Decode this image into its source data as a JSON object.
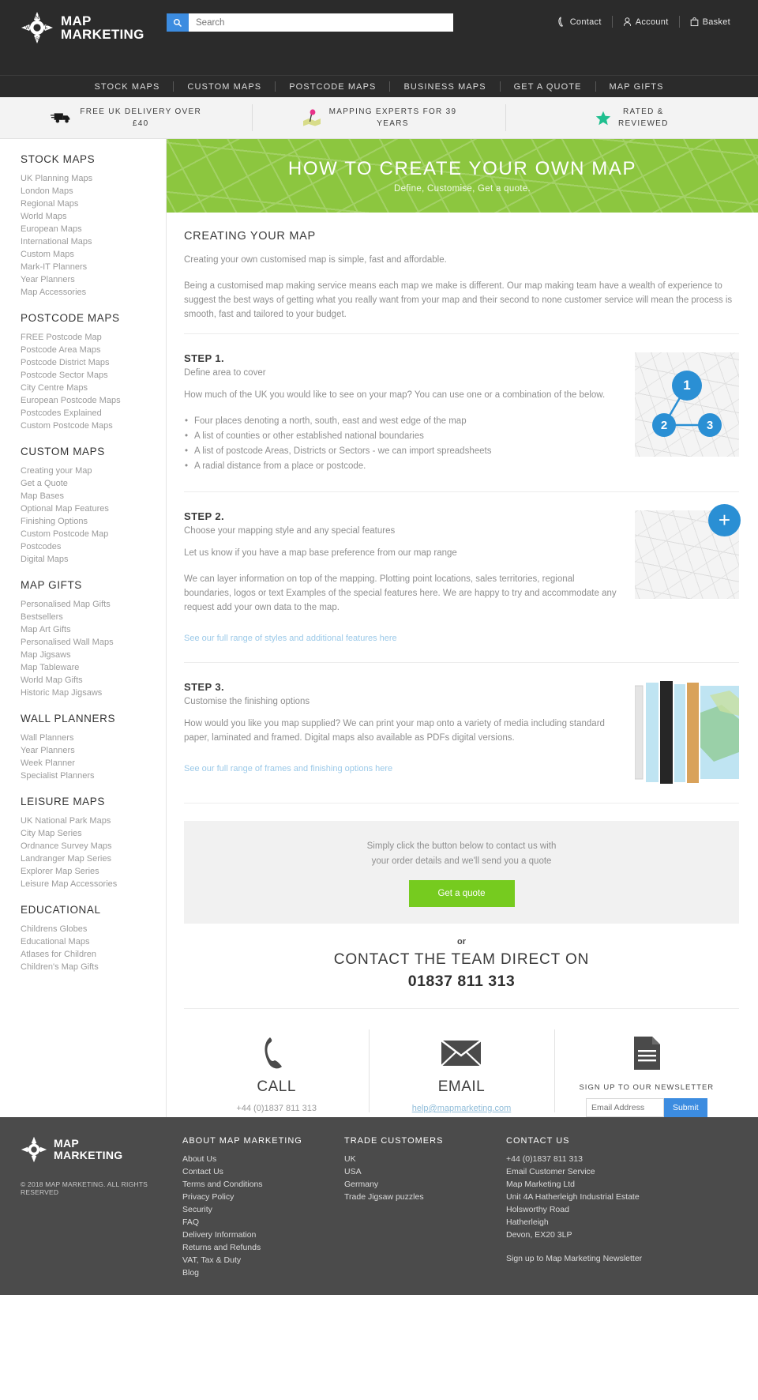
{
  "header": {
    "logo_line1": "MAP",
    "logo_line2": "MARKETING",
    "compass": {
      "n": "N",
      "e": "E",
      "s": "S",
      "w": "W"
    },
    "search": {
      "placeholder": "Search",
      "value": "",
      "icon": "search-icon"
    },
    "utility": [
      {
        "label": "Contact",
        "icon": "phone-icon"
      },
      {
        "label": "Account",
        "icon": "person-icon"
      },
      {
        "label": "Basket",
        "icon": "basket-icon"
      }
    ],
    "nav": [
      "STOCK MAPS",
      "CUSTOM MAPS",
      "POSTCODE MAPS",
      "BUSINESS MAPS",
      "GET A QUOTE",
      "MAP GIFTS"
    ]
  },
  "promo": [
    {
      "icon": "truck-icon",
      "line1": "FREE UK DELIVERY OVER",
      "line2": "£40"
    },
    {
      "icon": "map-pin-icon",
      "line1": "MAPPING EXPERTS FOR 39",
      "line2": "YEARS"
    },
    {
      "icon": "star-icon",
      "line1": "RATED &",
      "line2": "REVIEWED"
    }
  ],
  "sidebar": [
    {
      "heading": "STOCK MAPS",
      "items": [
        "UK Planning Maps",
        "London Maps",
        "Regional Maps",
        "World Maps",
        "European Maps",
        "International Maps",
        "Custom Maps",
        "Mark-IT Planners",
        "Year Planners",
        "Map Accessories"
      ]
    },
    {
      "heading": "POSTCODE MAPS",
      "items": [
        "FREE Postcode Map",
        "Postcode Area Maps",
        "Postcode District Maps",
        "Postcode Sector Maps",
        "City Centre Maps",
        "European Postcode Maps",
        "Postcodes Explained",
        "Custom Postcode Maps"
      ]
    },
    {
      "heading": "CUSTOM MAPS",
      "items": [
        "Creating your Map",
        "Get a Quote",
        "Map Bases",
        "Optional Map Features",
        "Finishing Options",
        "Custom Postcode Map",
        "Postcodes",
        "Digital Maps"
      ]
    },
    {
      "heading": "MAP GIFTS",
      "items": [
        "Personalised Map Gifts",
        "Bestsellers",
        "Map Art Gifts",
        "Personalised Wall Maps",
        "Map Jigsaws",
        "Map Tableware",
        "World Map Gifts",
        "Historic Map Jigsaws"
      ]
    },
    {
      "heading": "WALL PLANNERS",
      "items": [
        "Wall Planners",
        "Year Planners",
        "Week Planner",
        "Specialist Planners"
      ]
    },
    {
      "heading": "LEISURE MAPS",
      "items": [
        "UK National Park Maps",
        "City Map Series",
        "Ordnance Survey Maps",
        "Landranger Map Series",
        "Explorer Map Series",
        "Leisure Map Accessories"
      ]
    },
    {
      "heading": "EDUCATIONAL",
      "items": [
        "Childrens Globes",
        "Educational Maps",
        "Atlases for Children",
        "Children's Map Gifts"
      ]
    }
  ],
  "hero": {
    "title": "HOW TO CREATE YOUR OWN MAP",
    "subtitle": "Define, Customise, Get a quote."
  },
  "main": {
    "section_title": "CREATING YOUR MAP",
    "intro1": "Creating your own customised map is simple, fast and affordable.",
    "intro2": "Being a customised map making service means each map we make is different. Our map making team have a wealth of experience to suggest the best ways of getting what you really want from your map and their second to none customer service will mean the process is smooth, fast and tailored to your budget.",
    "steps": [
      {
        "heading": "STEP 1.",
        "subheading": "Define area to cover",
        "body": "How much of the UK you would like to see on your map? You can use one or a combination of the below.",
        "bullets": [
          "Four places denoting a north, south, east and west edge of the map",
          "A list of counties or other established national boundaries",
          "A list of postcode Areas, Districts or Sectors - we can import spreadsheets",
          "A radial distance from a place or postcode."
        ],
        "link": "",
        "image_badges": [
          "1",
          "2",
          "3"
        ]
      },
      {
        "heading": "STEP 2.",
        "subheading": "Choose your mapping style and any special features",
        "body": "Let us know if you have a map base preference from our map range",
        "body2": "We can layer information on top of the mapping. Plotting point locations, sales territories, regional boundaries, logos or text Examples of the special features here. We are happy to try and accommodate any request add your own data to the map.",
        "link": "See our full range of styles and additional features here",
        "image_badges": [
          "+"
        ]
      },
      {
        "heading": "STEP 3.",
        "subheading": "Customise the finishing options",
        "body": "How would you like you map supplied? We can print your map onto a variety of media including standard paper, laminated and framed. Digital maps also available as PDFs digital versions.",
        "link": "See our full range of frames and finishing options here",
        "image_badges": []
      }
    ],
    "quote_box": {
      "line1": "Simply click the button below to contact us with",
      "line2": "your order details and we'll send you a quote",
      "button": "Get a quote"
    },
    "or": "or",
    "contact_direct": "CONTACT THE TEAM DIRECT ON",
    "contact_number": "01837 811 313"
  },
  "contact_row": {
    "call": {
      "icon": "phone-icon",
      "label": "CALL",
      "value": "+44 (0)1837 811 313"
    },
    "email": {
      "icon": "envelope-icon",
      "label": "EMAIL",
      "value": "help@mapmarketing.com"
    },
    "newsletter": {
      "icon": "document-icon",
      "label": "SIGN UP TO OUR NEWSLETTER",
      "placeholder": "Email Address",
      "value": "",
      "button": "Submit"
    }
  },
  "footer": {
    "logo_line1": "MAP",
    "logo_line2": "MARKETING",
    "copyright": "© 2018 MAP MARKETING. ALL RIGHTS RESERVED",
    "col1": {
      "heading": "ABOUT MAP MARKETING",
      "items": [
        "About Us",
        "Contact Us",
        "Terms and Conditions",
        "Privacy Policy",
        "Security",
        "FAQ",
        "Delivery Information",
        "Returns and Refunds",
        "VAT, Tax & Duty",
        "Blog"
      ]
    },
    "col2": {
      "heading": "TRADE CUSTOMERS",
      "items": [
        "UK",
        "USA",
        "Germany",
        "Trade Jigsaw puzzles"
      ]
    },
    "col3": {
      "heading": "CONTACT US",
      "items": [
        "+44 (0)1837 811 313",
        "Email Customer Service",
        "Map Marketing Ltd",
        "Unit 4A Hatherleigh Industrial Estate",
        "Holsworthy Road",
        "Hatherleigh",
        "Devon, EX20 3LP"
      ],
      "newsletter_link": "Sign up to Map Marketing Newsletter"
    }
  },
  "colors": {
    "dark": "#2b2b2b",
    "accent_blue": "#3c8ce0",
    "hero_green": "#8cc63f",
    "button_green": "#76cb1f",
    "footer_grey": "#4b4b4b",
    "link_blue": "#9bc9e8"
  }
}
